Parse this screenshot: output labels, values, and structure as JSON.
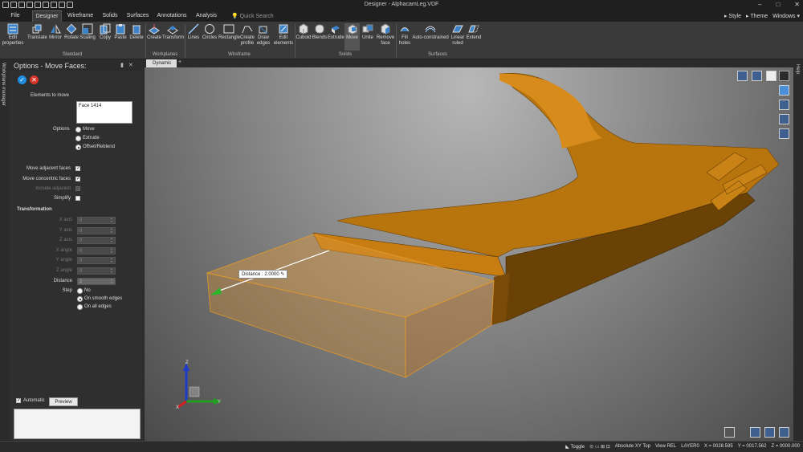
{
  "window": {
    "title": "Designer - AlphacamLeg.VDF",
    "controls": [
      "–",
      "□",
      "✕"
    ]
  },
  "tabs": [
    "File",
    "Designer",
    "Wireframe",
    "Solids",
    "Surfaces",
    "Annotations",
    "Analysis"
  ],
  "active_tab": "Designer",
  "quick_search": "Quick Search",
  "right_menus": [
    "Style",
    "Theme",
    "Windows"
  ],
  "ribbon": {
    "standard": [
      "Edit properties",
      "Translate",
      "Mirror",
      "Rotate",
      "Scaling",
      "Copy",
      "Paste",
      "Delete"
    ],
    "workplanes": [
      "Create",
      "Transform"
    ],
    "wireframe": [
      "Lines",
      "Circles",
      "Rectangle",
      "Create profile",
      "Draw edges",
      "Edit elements"
    ],
    "solids": [
      "Cuboid",
      "Blends",
      "Extrude",
      "Move",
      "Unite",
      "Remove face"
    ],
    "surfaces": [
      "Fill holes",
      "Auto-constrained",
      "Linear ruled",
      "Extend"
    ],
    "groups": [
      "Standard",
      "Workplanes",
      "Wireframe",
      "Solids",
      "Surfaces"
    ]
  },
  "panel": {
    "side_tab": "Workplane manager",
    "title": "Options - Move Faces:",
    "elements_to_move_label": "Elements to move",
    "face_value": "Face 1414",
    "options_label": "Options",
    "options": [
      "Move",
      "Extrude",
      "Offset/Reblend"
    ],
    "options_selected": 2,
    "checks": [
      {
        "label": "Move adjacent faces",
        "checked": true,
        "disabled": false
      },
      {
        "label": "Move concentric faces",
        "checked": true,
        "disabled": false
      },
      {
        "label": "Include adjacent",
        "checked": false,
        "disabled": true
      },
      {
        "label": "Simplify",
        "checked": false,
        "disabled": false
      }
    ],
    "transformation_label": "Transformation",
    "fields": [
      {
        "label": "X axis",
        "value": "0"
      },
      {
        "label": "Y axis",
        "value": "0"
      },
      {
        "label": "Z axis",
        "value": "0"
      },
      {
        "label": "X angle",
        "value": "0"
      },
      {
        "label": "Y angle",
        "value": "0"
      },
      {
        "label": "Z angle",
        "value": "0"
      },
      {
        "label": "Distance",
        "value": "2"
      }
    ],
    "step_label": "Step",
    "step_options": [
      "No",
      "On smooth edges",
      "On all edges"
    ],
    "step_selected": 1,
    "automatic_label": "Automatic",
    "automatic_checked": true,
    "preview_label": "Preview"
  },
  "viewport": {
    "tab": "Dynamic",
    "plus": "+",
    "distance_label": "Distance : 2.0000",
    "right_tab": "Help"
  },
  "axes": {
    "x": "X",
    "y": "Y",
    "z": "Z"
  },
  "status": {
    "toggle": "Toggle",
    "view": "Absolute XY Top",
    "view_rel": "View REL",
    "layer": "LAYER0",
    "x": "X = 0028.595",
    "y": "Y = 0017.562",
    "z": "Z = 0000.000"
  },
  "colors": {
    "solid": "#c97d10",
    "selection": "#f0b060",
    "accent": "#1e8fe0"
  }
}
